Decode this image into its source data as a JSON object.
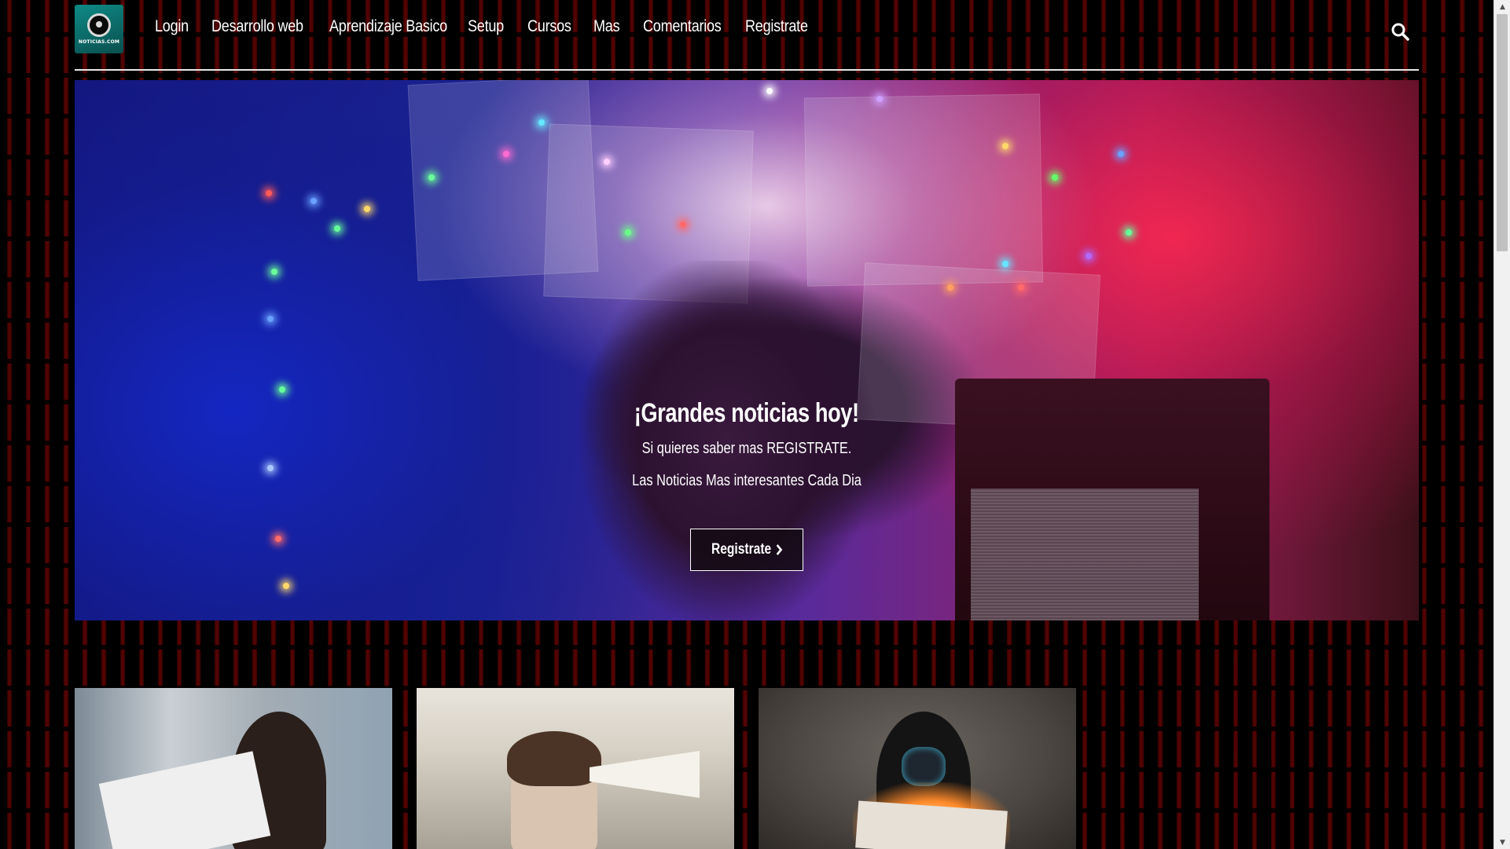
{
  "header": {
    "logo_text": "NOTICIAS.COM",
    "nav_items": [
      {
        "label": "Login"
      },
      {
        "label": "Desarrollo web"
      },
      {
        "label": "Aprendizaje Basico"
      },
      {
        "label": "Setup"
      },
      {
        "label": "Cursos"
      },
      {
        "label": "Mas"
      },
      {
        "label": "Comentarios"
      },
      {
        "label": "Registrate"
      }
    ],
    "search_icon": "search-icon"
  },
  "hero": {
    "title": "¡Grandes noticias hoy!",
    "subtitle": "Si quieres saber mas REGISTRATE.",
    "tagline": "Las Noticias Mas interesantes Cada Dia",
    "button_label": "Registrate",
    "button_icon": "chevron-right-icon"
  },
  "cards": [
    {
      "image": "woman-reading-newspaper-on-bus"
    },
    {
      "image": "woman-shouting-into-megaphone"
    },
    {
      "image": "hooded-person-with-burning-newspaper"
    }
  ],
  "colors": {
    "background": "#000000",
    "stripe": "#5a0505",
    "text": "#ffffff",
    "divider": "#e8e8e8"
  }
}
